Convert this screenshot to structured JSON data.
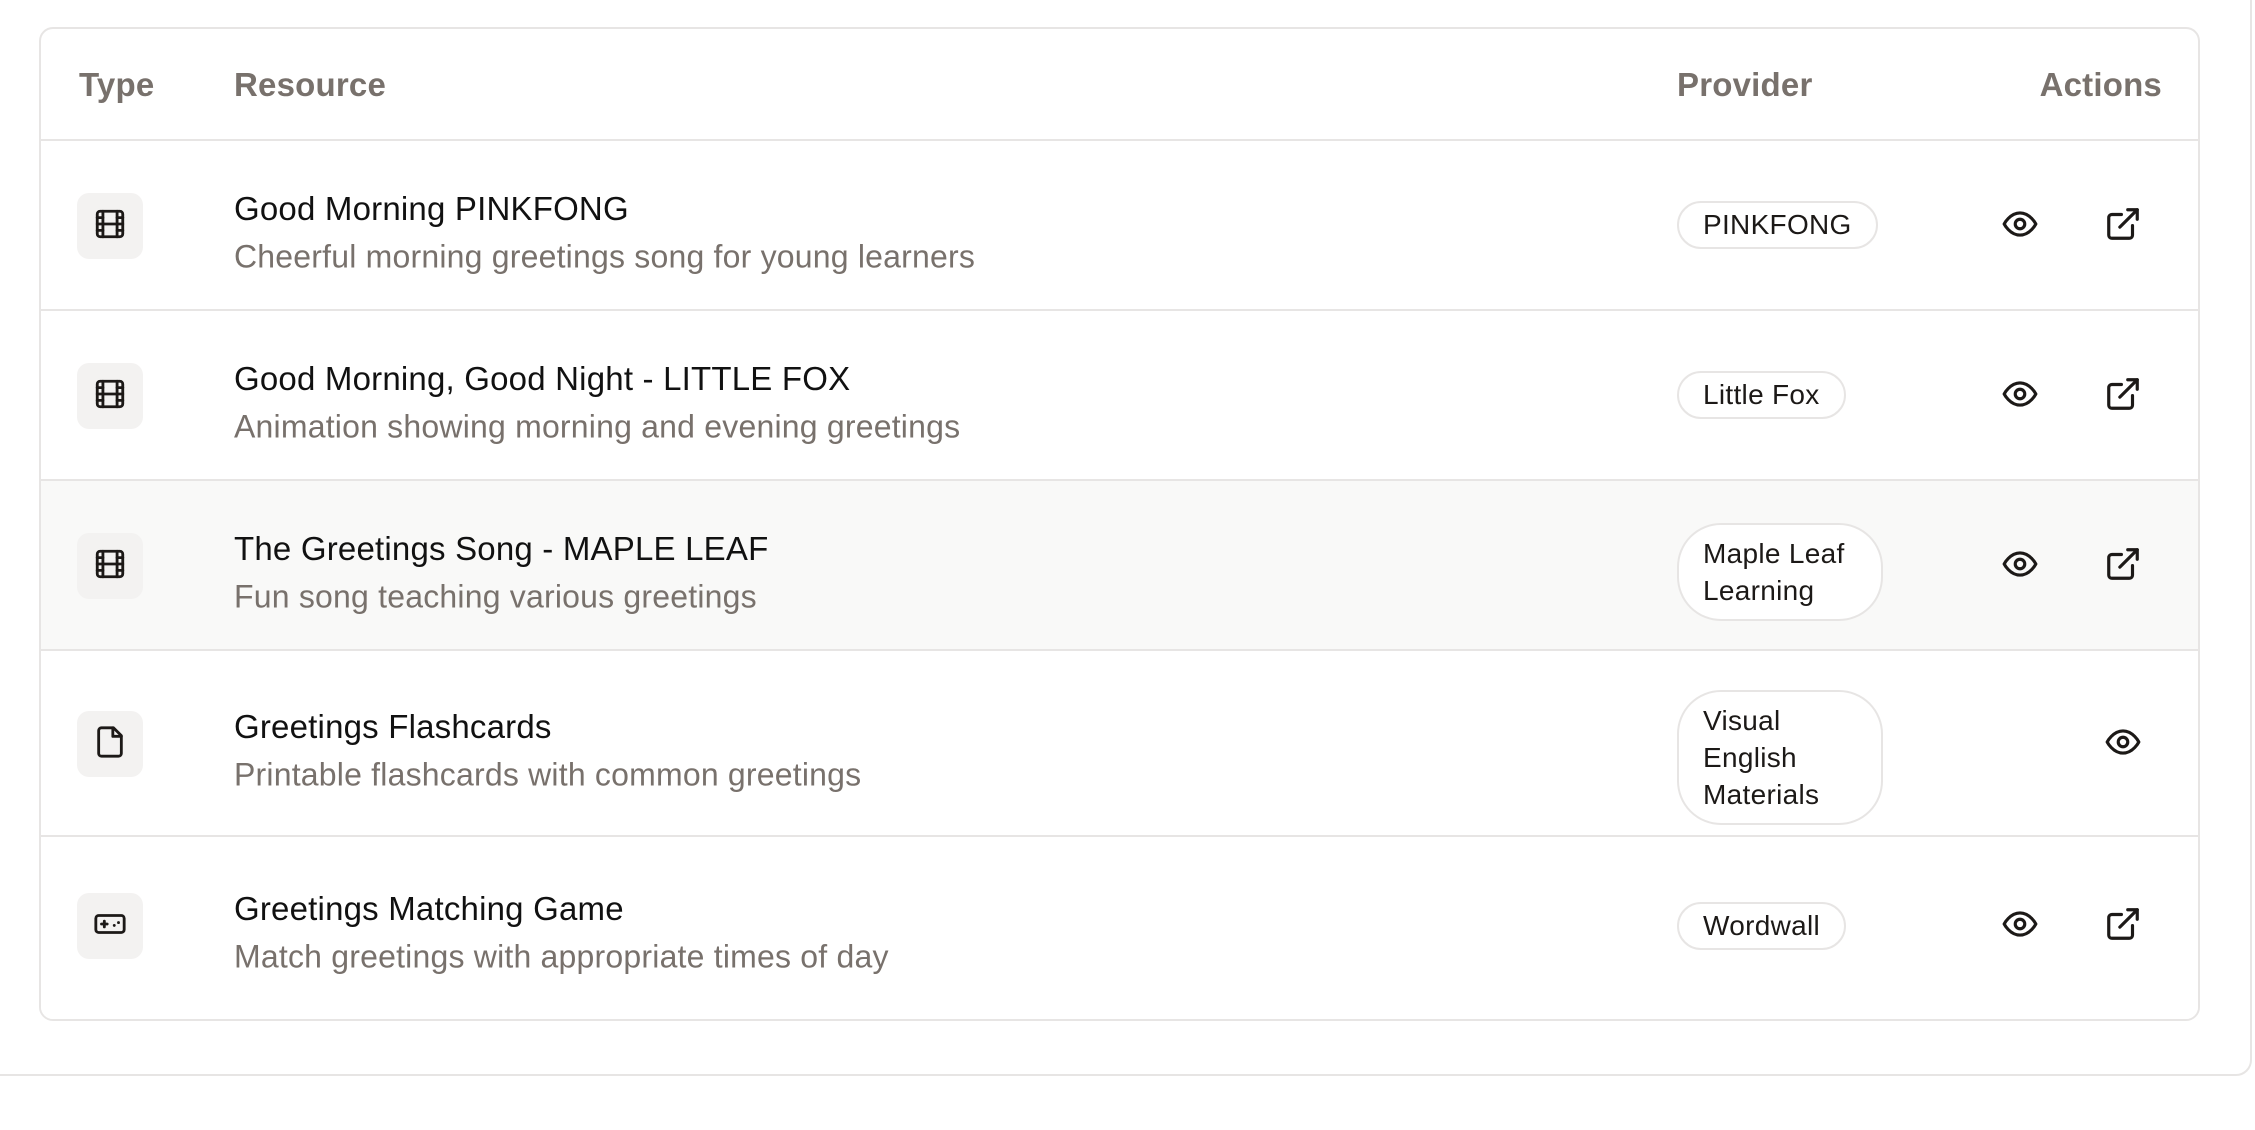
{
  "table": {
    "headers": {
      "type": "Type",
      "resource": "Resource",
      "provider": "Provider",
      "actions": "Actions"
    },
    "rows": [
      {
        "type_icon": "film-icon",
        "title": "Good Morning PINKFONG",
        "description": "Cheerful morning greetings song for young learners",
        "provider": "PINKFONG",
        "actions": [
          "view",
          "open-external"
        ]
      },
      {
        "type_icon": "film-icon",
        "title": "Good Morning, Good Night - LITTLE FOX",
        "description": "Animation showing morning and evening greetings",
        "provider": "Little Fox",
        "actions": [
          "view",
          "open-external"
        ]
      },
      {
        "type_icon": "film-icon",
        "title": "The Greetings Song - MAPLE LEAF",
        "description": "Fun song teaching various greetings",
        "provider": "Maple Leaf Learning",
        "actions": [
          "view",
          "open-external"
        ]
      },
      {
        "type_icon": "file-icon",
        "title": "Greetings Flashcards",
        "description": "Printable flashcards with common greetings",
        "provider": "Visual English Materials",
        "actions": [
          "view"
        ]
      },
      {
        "type_icon": "gamepad-icon",
        "title": "Greetings Matching Game",
        "description": "Match greetings with appropriate times of day",
        "provider": "Wordwall",
        "actions": [
          "view",
          "open-external"
        ]
      }
    ]
  },
  "colors": {
    "border": "#e7e5e4",
    "muted_text": "#78716c",
    "row_hover": "#f9f9f8",
    "icon_bg": "#f3f2f1"
  }
}
